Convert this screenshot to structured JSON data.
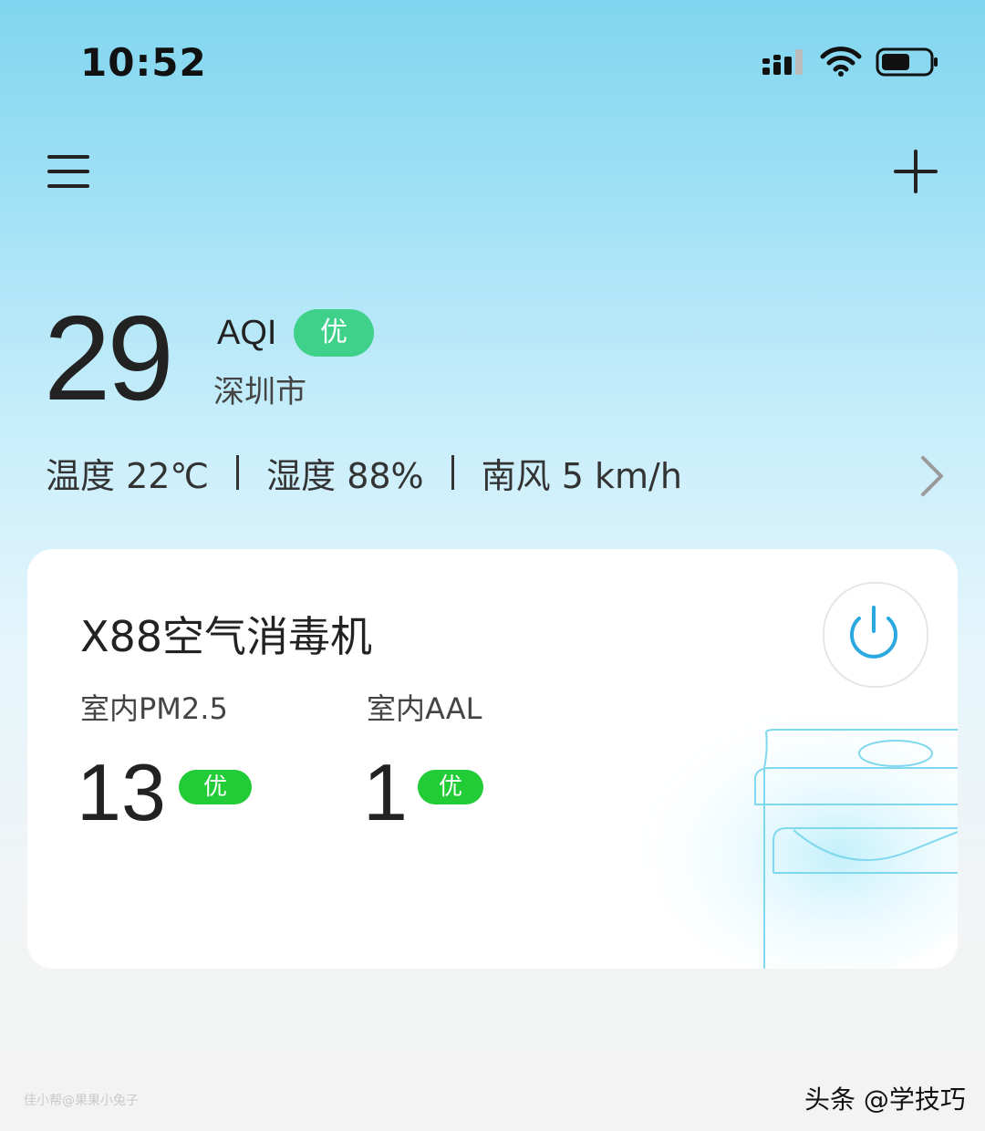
{
  "status_bar": {
    "time": "10:52"
  },
  "top_bar": {
    "menu_icon": "hamburger-menu-icon",
    "add_icon": "plus-icon"
  },
  "aqi": {
    "value": "29",
    "label": "AQI",
    "level": "优",
    "city": "深圳市"
  },
  "weather": {
    "temperature": "温度 22℃",
    "humidity": "湿度 88%",
    "wind": "南风 5 km/h"
  },
  "device": {
    "name": "X88空气消毒机",
    "pm25_label": "室内PM2.5",
    "pm25_value": "13",
    "pm25_level": "优",
    "aal_label": "室内AAL",
    "aal_value": "1",
    "aal_level": "优"
  },
  "watermarks": {
    "left": "佳小帮@果果小兔子",
    "right": "头条 @学技巧"
  },
  "colors": {
    "aqi_badge": "#3fd08a",
    "level_badge": "#22cc36",
    "power_icon": "#2aa8e0",
    "sky_top": "#7fd5ef"
  }
}
